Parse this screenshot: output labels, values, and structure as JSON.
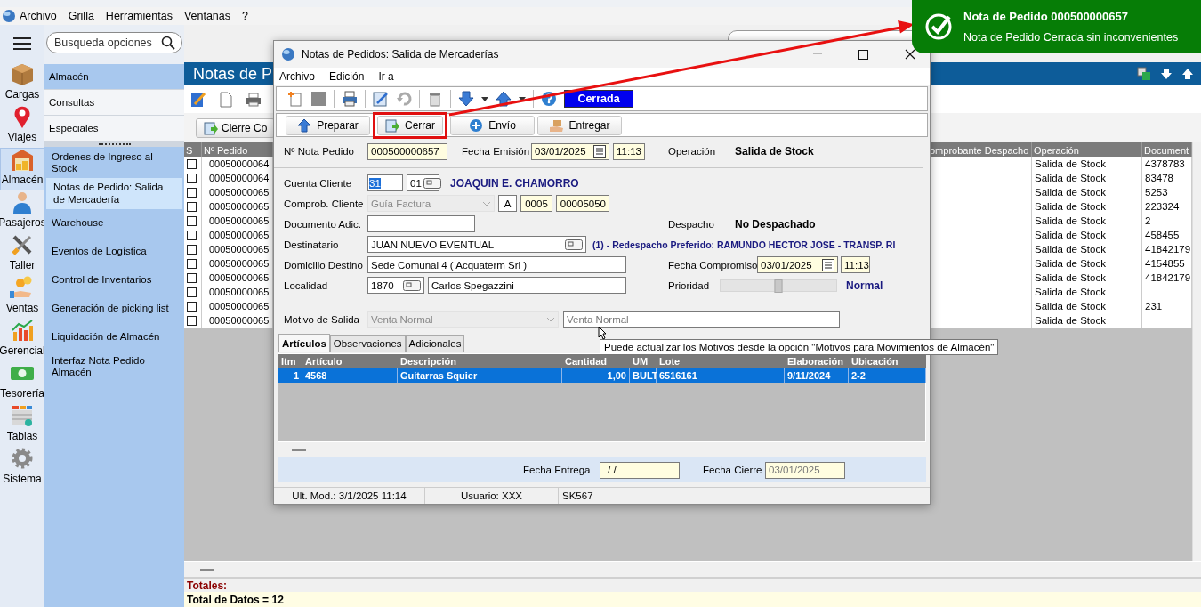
{
  "menu_bar": [
    "Archivo",
    "Grilla",
    "Herramientas",
    "Ventanas",
    "?"
  ],
  "rail": [
    {
      "label": "Cargas",
      "selected": false
    },
    {
      "label": "Viajes",
      "selected": false
    },
    {
      "label": "Almacén",
      "selected": true
    },
    {
      "label": "Pasajeros",
      "selected": false
    },
    {
      "label": "Taller",
      "selected": false
    },
    {
      "label": "Ventas",
      "selected": false
    },
    {
      "label": "Gerencial",
      "selected": false
    },
    {
      "label": "Tesorería",
      "selected": false
    },
    {
      "label": "Tablas",
      "selected": false
    },
    {
      "label": "Sistema",
      "selected": false
    }
  ],
  "search": {
    "placeholder": "Busqueda opciones"
  },
  "nav_groups": [
    {
      "label": "Almacén",
      "selected": true
    },
    {
      "label": "Consultas",
      "selected": false
    },
    {
      "label": "Especiales",
      "selected": false
    }
  ],
  "nav_items": [
    {
      "label": "Ordenes de Ingreso al Stock",
      "selected": false
    },
    {
      "label": "Notas de Pedido: Salida de Mercadería",
      "selected": true
    },
    {
      "label": "Warehouse",
      "selected": false
    },
    {
      "label": "Eventos de Logística",
      "selected": false
    },
    {
      "label": "Control de Inventarios",
      "selected": false
    },
    {
      "label": "Generación de picking list",
      "selected": false
    },
    {
      "label": "Liquidación de Almacén",
      "selected": false
    },
    {
      "label": "Interfaz Nota Pedido Almacén",
      "selected": false
    }
  ],
  "main": {
    "title": "Notas de P",
    "button": "Cierre Co"
  },
  "table": {
    "columns": [
      "S",
      "Nº Pedido",
      "omprobante Despacho",
      "Operación",
      "Document"
    ],
    "rows": [
      {
        "checked": false,
        "pedido": "00050000064",
        "operacion": "Salida de Stock",
        "documento": "4378783"
      },
      {
        "checked": false,
        "pedido": "00050000064",
        "operacion": "Salida de Stock",
        "documento": "83478"
      },
      {
        "checked": false,
        "pedido": "00050000065",
        "operacion": "Salida de Stock",
        "documento": "5253"
      },
      {
        "checked": false,
        "pedido": "00050000065",
        "operacion": "Salida de Stock",
        "documento": "223324"
      },
      {
        "checked": false,
        "pedido": "00050000065",
        "operacion": "Salida de Stock",
        "documento": "2"
      },
      {
        "checked": false,
        "pedido": "00050000065",
        "operacion": "Salida de Stock",
        "documento": "458455"
      },
      {
        "checked": false,
        "pedido": "00050000065",
        "operacion": "Salida de Stock",
        "documento": "41842179"
      },
      {
        "checked": false,
        "pedido": "00050000065",
        "operacion": "Salida de Stock",
        "documento": "4154855"
      },
      {
        "checked": false,
        "pedido": "00050000065",
        "operacion": "Salida de Stock",
        "documento": "41842179"
      },
      {
        "checked": false,
        "pedido": "00050000065",
        "operacion": "Salida de Stock"
      },
      {
        "checked": false,
        "pedido": "00050000065",
        "operacion": "Salida de Stock",
        "documento": "231"
      },
      {
        "checked": false,
        "pedido": "00050000065",
        "operacion": "Salida de Stock"
      }
    ]
  },
  "totals": {
    "label": "Totales:",
    "count": "Total de Datos = 12"
  },
  "dialog": {
    "title": "Notas de Pedidos: Salida de Mercaderías",
    "menu": [
      "Archivo",
      "Edición",
      "Ir a"
    ],
    "status": "Cerrada",
    "actions": [
      {
        "label": "Preparar",
        "highlighted": false
      },
      {
        "label": "Cerrar",
        "highlighted": true
      },
      {
        "label": "Envío",
        "highlighted": false
      },
      {
        "label": "Entregar",
        "highlighted": false
      }
    ],
    "nota_pedido": {
      "label": "Nº Nota Pedido",
      "value": "000500000657"
    },
    "fecha_emision": {
      "label": "Fecha Emisión",
      "date": "03/01/2025",
      "time": "11:13"
    },
    "operacion": {
      "label": "Operación",
      "value": "Salida de Stock"
    },
    "cuenta_cliente": {
      "label": "Cuenta Cliente",
      "code": "31",
      "code_highlighted": true,
      "branch": "01",
      "name": "JOAQUIN E. CHAMORRO"
    },
    "comprob_cliente": {
      "label": "Comprob. Cliente",
      "type": "Guía Factura",
      "type_disabled": true,
      "letter": "A",
      "point": "0005",
      "number": "00005050"
    },
    "documento_adic": {
      "label": "Documento Adic."
    },
    "despacho": {
      "label": "Despacho",
      "value": "No Despachado"
    },
    "destinatario": {
      "label": "Destinatario",
      "value": "JUAN NUEVO EVENTUAL",
      "note": "(1) - Redespacho Preferido: RAMUNDO HECTOR JOSE - TRANSP. RI"
    },
    "domicilio": {
      "label": "Domicilio Destino",
      "value": "Sede Comunal 4 ( Acquaterm Srl )"
    },
    "fecha_compromiso": {
      "label": "Fecha Compromiso",
      "date": "03/01/2025",
      "time": "11:13"
    },
    "localidad": {
      "label": "Localidad",
      "code": "1870",
      "name": "Carlos Spegazzini"
    },
    "prioridad": {
      "label": "Prioridad",
      "level": 0.5,
      "value": "Normal"
    },
    "motivo": {
      "label": "Motivo de Salida",
      "type": "Venta Normal",
      "type_disabled": true,
      "value": "Venta Normal"
    },
    "tabs": [
      {
        "label": "Artículos",
        "selected": true
      },
      {
        "label": "Observaciones",
        "selected": false
      },
      {
        "label": "Adicionales",
        "selected": false
      }
    ],
    "grid": {
      "columns": [
        "Itm",
        "Artículo",
        "Descripción",
        "Cantidad",
        "UM",
        "Lote",
        "Elaboración",
        "Ubicación"
      ],
      "rows": [
        {
          "selected": true,
          "cells": [
            "1",
            "4568",
            "Guitarras Squier",
            "1,00",
            "BULT",
            "6516161",
            "9/11/2024",
            "2-2"
          ]
        }
      ]
    },
    "fecha_entrega": {
      "label": "Fecha Entrega",
      "value": "/ /"
    },
    "fecha_cierre": {
      "label": "Fecha Cierre",
      "value": "03/01/2025",
      "disabled": true
    },
    "status_bar": [
      "Ult. Mod.: 3/1/2025 11:14",
      "Usuario: XXX",
      "SK567"
    ]
  },
  "tooltip": "Puede actualizar los Motivos desde la opción \"Motivos para Movimientos de Almacén\"",
  "toast": {
    "title": "Nota de Pedido 000500000657",
    "message": "Nota de Pedido Cerrada sin inconvenientes"
  }
}
